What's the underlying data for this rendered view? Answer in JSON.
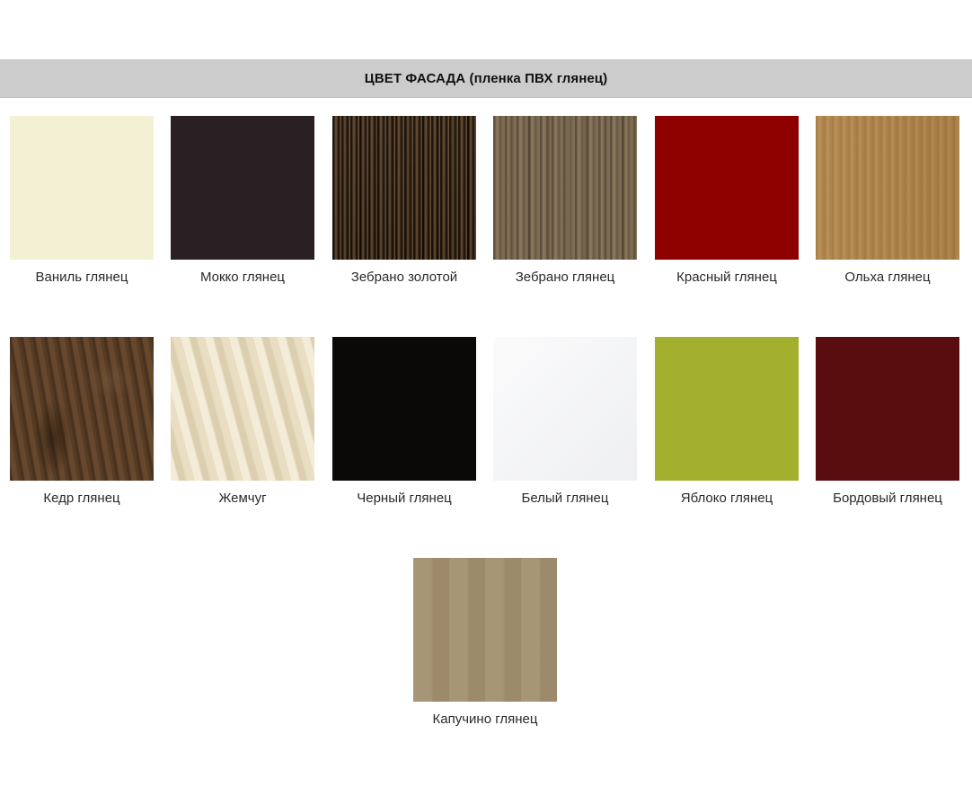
{
  "header": {
    "title": "ЦВЕТ ФАСАДА (пленка ПВХ глянец)"
  },
  "swatches": [
    {
      "label": "Ваниль глянец",
      "color": "#f3f0d3"
    },
    {
      "label": "Мокко глянец",
      "color": "#2a2023"
    },
    {
      "label": "Зебрано золотой",
      "color": "#3a2a1c"
    },
    {
      "label": "Зебрано глянец",
      "color": "#7b6a52"
    },
    {
      "label": "Красный глянец",
      "color": "#8e0000"
    },
    {
      "label": "Ольха глянец",
      "color": "#b0854a"
    },
    {
      "label": "Кедр глянец",
      "color": "#5e4128"
    },
    {
      "label": "Жемчуг",
      "color": "#e4d8ba"
    },
    {
      "label": "Черный глянец",
      "color": "#0b0908"
    },
    {
      "label": "Белый глянец",
      "color": "#f6f7f8"
    },
    {
      "label": "Яблоко глянец",
      "color": "#a2b02e"
    },
    {
      "label": "Бордовый глянец",
      "color": "#5a0d0f"
    },
    {
      "label": "Капучино глянец",
      "color": "#a2906f"
    }
  ]
}
